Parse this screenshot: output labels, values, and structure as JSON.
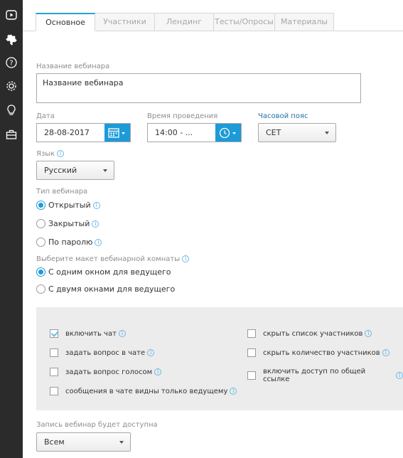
{
  "sidebar": {
    "items": [
      {
        "icon": "youtube-icon"
      },
      {
        "icon": "puzzle-icon"
      },
      {
        "icon": "help-icon"
      },
      {
        "icon": "gear-icon"
      },
      {
        "icon": "lightbulb-icon"
      },
      {
        "icon": "toolbox-icon"
      }
    ]
  },
  "tabs": [
    "Основное",
    "Участники",
    "Лендинг",
    "Тесты/Опросы",
    "Материалы"
  ],
  "form": {
    "title_label": "Название вебинара",
    "title_value": "Название вебинара",
    "date_label": "Дата",
    "date_value": "28-08-2017",
    "time_label": "Время проведения",
    "time_value": "14:00 - ...",
    "timezone_label": "Часовой пояс",
    "timezone_value": "CET",
    "language_label": "Язык",
    "language_value": "Русский",
    "type_label": "Тип вебинара",
    "type_options": [
      "Открытый",
      "Закрытый",
      "По паролю"
    ],
    "type_selected": "Открытый",
    "layout_label": "Выберите макет вебинарной комнаты",
    "layout_options": [
      "С одним окном для ведущего",
      "С двумя окнами для ведущего"
    ],
    "layout_selected": "С одним окном для ведущего",
    "recording_label": "Запись вебинар будет доступна",
    "recording_value": "Всем"
  },
  "options": {
    "left": [
      {
        "label": "включить чат",
        "checked": true
      },
      {
        "label": "задать вопрос в чате",
        "checked": false
      },
      {
        "label": "задать вопрос голосом",
        "checked": false
      },
      {
        "label": "сообщения в чате видны только ведущему",
        "checked": false
      }
    ],
    "right": [
      {
        "label": "скрыть список участников",
        "checked": false
      },
      {
        "label": "скрыть количество участников",
        "checked": false
      },
      {
        "label": "включить доступ по общей ссылке",
        "checked": false
      }
    ]
  },
  "colors": {
    "accent": "#1d9ad8",
    "sidebar": "#2b2b2b",
    "panel": "#ececec"
  }
}
